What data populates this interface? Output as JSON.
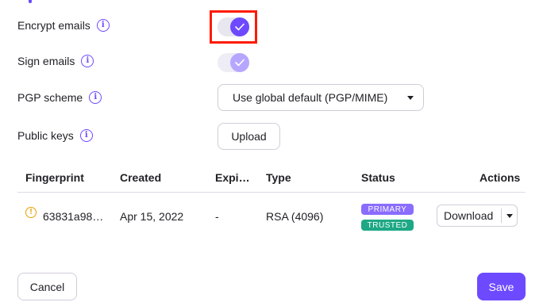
{
  "settings": {
    "encrypt_emails": {
      "label": "Encrypt emails",
      "state": "on"
    },
    "sign_emails": {
      "label": "Sign emails",
      "state": "on-disabled"
    },
    "pgp_scheme": {
      "label": "PGP scheme",
      "value": "Use global default (PGP/MIME)"
    },
    "public_keys": {
      "label": "Public keys",
      "upload_label": "Upload"
    }
  },
  "table": {
    "headers": [
      "Fingerprint",
      "Created",
      "Expi…",
      "Type",
      "Status",
      "Actions"
    ],
    "rows": [
      {
        "fingerprint": "63831a98…",
        "created": "Apr 15, 2022",
        "expires": "-",
        "type": "RSA (4096)",
        "badges": [
          "PRIMARY",
          "TRUSTED"
        ],
        "action": "Download"
      }
    ]
  },
  "footer": {
    "cancel_label": "Cancel",
    "save_label": "Save"
  },
  "icons": {
    "info": "info-icon",
    "check": "check-icon",
    "warning": "warning-icon",
    "caret": "chevron-down-icon"
  },
  "colors": {
    "accent": "#6d4aff",
    "primary_badge": "#8a6cff",
    "trusted_badge": "#1ea885",
    "highlight": "#ff1a00",
    "warning": "#e8a000"
  }
}
